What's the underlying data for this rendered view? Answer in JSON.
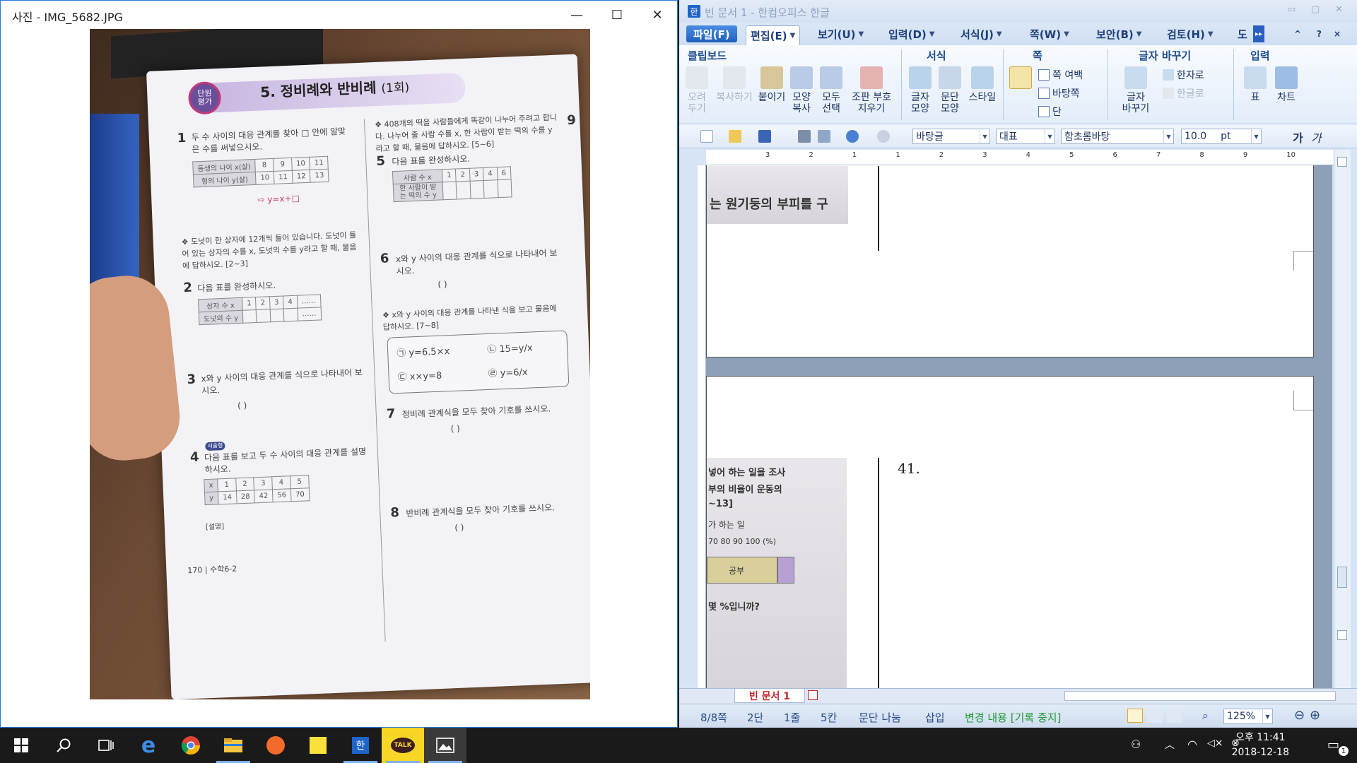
{
  "photo_viewer": {
    "title": "사진 - IMG_5682.JPG",
    "buttons": {
      "minimize": "—",
      "maximize": "☐",
      "close": "✕"
    },
    "page": {
      "unit_badge": "단원\n평가",
      "heading": "5. 정비례와 반비례",
      "heading_sub": "(1회)",
      "q1_num": "1",
      "q1_text": "두 수 사이의 대응 관계를 찾아 □ 안에 알맞은 수를 써넣으시오.",
      "q1_table": [
        [
          "동생의 나이 x(살)",
          "8",
          "9",
          "10",
          "11"
        ],
        [
          "형의 나이 y(살)",
          "10",
          "11",
          "12",
          "13"
        ]
      ],
      "q1_formula": "⇨ y=x+□",
      "q23_intro": "❖ 도넛이 한 상자에 12개씩 들어 있습니다. 도넛이 들어 있는 상자의 수를 x, 도넛의 수를 y라고 할 때, 물음에 답하시오. [2~3]",
      "q2_num": "2",
      "q2_text": "다음 표를 완성하시오.",
      "q2_table": [
        [
          "상자 수 x",
          "1",
          "2",
          "3",
          "4",
          "……"
        ],
        [
          "도넛의 수 y",
          "",
          "",
          "",
          "",
          "……"
        ]
      ],
      "q3_num": "3",
      "q3_text": "x와 y 사이의 대응 관계를 식으로 나타내어 보시오.",
      "q4_num": "4",
      "q4_tag": "서술형",
      "q4_text": "다음 표를 보고 두 수 사이의 대응 관계를 설명하시오.",
      "q4_table": [
        [
          "x",
          "1",
          "2",
          "3",
          "4",
          "5"
        ],
        [
          "y",
          "14",
          "28",
          "42",
          "56",
          "70"
        ]
      ],
      "q4_answer_label": "[설명]",
      "q56_intro": "❖ 408개의 떡을 사람들에게 똑같이 나누어 주려고 합니다. 나누어 줄 사람 수를 x, 한 사람이 받는 떡의 수를 y라고 할 때, 물음에 답하시오. [5~6]",
      "q5_num": "5",
      "q5_text": "다음 표를 완성하시오.",
      "q5_table": [
        [
          "사람 수 x",
          "1",
          "2",
          "3",
          "4",
          "6"
        ],
        [
          "한 사람이 받는 떡의 수 y",
          "",
          "",
          "",
          "",
          ""
        ]
      ],
      "q6_num": "6",
      "q6_text": "x와 y 사이의 대응 관계를 식으로 나타내어 보시오.",
      "q78_intro": "❖ x와 y 사이의 대응 관계를 나타낸 식을 보고 물음에 답하시오. [7~8]",
      "formulas": [
        "㉠ y=6.5×x",
        "㉡ 15=y/x",
        "㉢ x×y=8",
        "㉣ y=6/x"
      ],
      "q7_num": "7",
      "q7_text": "정비례 관계식을 모두 찾아 기호를 쓰시오.",
      "q8_num": "8",
      "q8_text": "반비례 관계식을 모두 찾아 기호를 쓰시오.",
      "paren": "(          )",
      "footer": "170 | 수학6-2",
      "right_edge_num": "9"
    }
  },
  "hwp": {
    "title": "빈 문서 1 - 한컴오피스 한글",
    "logo": "한",
    "window_buttons": [
      "▭",
      "▢",
      "✕"
    ],
    "menu": [
      {
        "label": "파일(F)",
        "type": "file"
      },
      {
        "label": "편집(E)",
        "type": "active"
      },
      {
        "label": "보기(U)"
      },
      {
        "label": "입력(D)"
      },
      {
        "label": "서식(J)"
      },
      {
        "label": "쪽(W)"
      },
      {
        "label": "보안(B)"
      },
      {
        "label": "검토(H)"
      },
      {
        "label": "도"
      }
    ],
    "menu_right": [
      "^",
      "?",
      "×"
    ],
    "ribbon": {
      "groups": {
        "clipboard": "클립보드",
        "format": "서식",
        "page": "쪽",
        "font_change": "글자 바꾸기",
        "input": "입력"
      },
      "buttons": {
        "cut": "오려\n두기",
        "copy": "복사하기",
        "paste": "붙이기",
        "shape_copy": "모양\n복사",
        "select_all": "모두\n선택",
        "clear_marks": "조판 부호\n지우기",
        "char_shape": "글자\n모양",
        "para_shape": "문단\n모양",
        "style": "스타일",
        "page_margin": "쪽 여백",
        "background": "바탕쪽",
        "columns": "단",
        "hanja": "한자로",
        "hangul": "한글로",
        "font_change_btn": "글자\n바꾸기",
        "table": "표",
        "chart": "차트"
      }
    },
    "toolbar": {
      "style_combo": "바탕글",
      "lang_combo": "대표",
      "font_combo": "함초롬바탕",
      "size_combo": "10.0",
      "size_unit": "pt",
      "bold": "가",
      "italic": "가"
    },
    "ruler_numbers": [
      "3",
      "2",
      "1",
      "1",
      "2",
      "3",
      "4",
      "5",
      "6",
      "7",
      "8",
      "9",
      "10"
    ],
    "doc": {
      "crop1_text": "는 원기둥의 부피를 구",
      "crop2_lines": [
        "넣어 하는 일을 조사",
        "부의 비율이 운동의",
        "~13]",
        "가 하는 일",
        "70   80   90   100 (%)",
        "공부",
        "몇 %입니까?"
      ],
      "page2_text": "41."
    },
    "doc_tab": "빈 문서 1",
    "status": {
      "page": "8/8쪽",
      "section": "2단",
      "line": "1줄",
      "column": "5칸",
      "para": "문단 나눔",
      "mode": "삽입",
      "track": "변경 내용 [기록 중지]",
      "zoom": "125%"
    }
  },
  "taskbar": {
    "clock_time": "오후 11:41",
    "clock_date": "2018-12-18",
    "notification_count": "1",
    "apps": [
      "start",
      "search",
      "task-view",
      "edge",
      "chrome",
      "file-explorer",
      "pen-app",
      "sticky-notes",
      "hancom-hwp",
      "kakaotalk",
      "photos"
    ],
    "kakao_label": "TALK"
  }
}
